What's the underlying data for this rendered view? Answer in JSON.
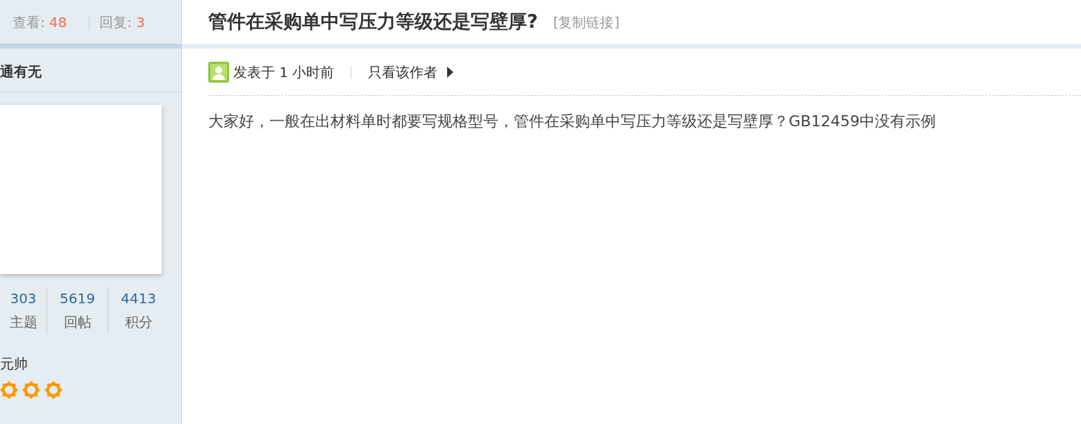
{
  "thread_stats": {
    "views_label": "查看:",
    "views": "48",
    "replies_label": "回复:",
    "replies": "3"
  },
  "author": {
    "group": "通有无",
    "stats": [
      {
        "value": "303",
        "label": "主题"
      },
      {
        "value": "5619",
        "label": "回帖"
      },
      {
        "value": "4413",
        "label": "积分"
      }
    ],
    "rank": "元帅",
    "rank_icons": [
      {
        "kind": "sun"
      },
      {
        "kind": "sun"
      },
      {
        "kind": "sun"
      }
    ]
  },
  "post": {
    "title": "管件在采购单中写压力等级还是写壁厚?",
    "copy_link": "[复制链接]",
    "posted": "发表于 1 小时前",
    "author_only": "只看该作者",
    "body": "大家好，一般在出材料单时都要写规格型号，管件在采购单中写压力等级还是写壁厚？GB12459中没有示例"
  }
}
